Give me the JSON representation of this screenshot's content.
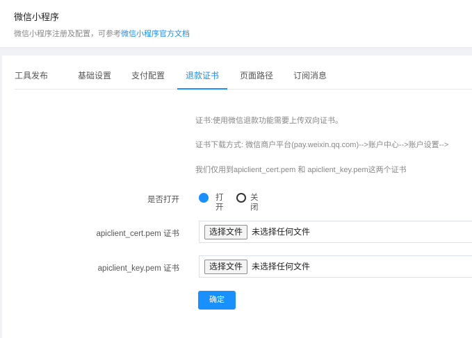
{
  "header": {
    "title": "微信小程序",
    "desc_prefix": "微信小程序注册及配置，可参考",
    "desc_link": "微信小程序官方文档"
  },
  "tabs": [
    {
      "label": "工具发布",
      "active": false
    },
    {
      "label": "基础设置",
      "active": false
    },
    {
      "label": "支付配置",
      "active": false
    },
    {
      "label": "退款证书",
      "active": true
    },
    {
      "label": "页面路径",
      "active": false
    },
    {
      "label": "订阅消息",
      "active": false
    }
  ],
  "notes": [
    "证书:使用微信退款功能需要上传双向证书。",
    "证书下载方式: 微信商户平台(pay.weixin.qq.com)-->账户中心-->账户设置-->",
    "我们仅用到apiclient_cert.pem 和 apiclient_key.pem这两个证书"
  ],
  "form": {
    "enable_label": "是否打开",
    "enable_on": "打开",
    "enable_off": "关闭",
    "enabled": true,
    "cert_label": "apiclient_cert.pem 证书",
    "key_label": "apiclient_key.pem 证书",
    "file_button": "选择文件",
    "file_status": "未选择任何文件",
    "confirm": "确定"
  },
  "colors": {
    "accent": "#1890ff"
  }
}
